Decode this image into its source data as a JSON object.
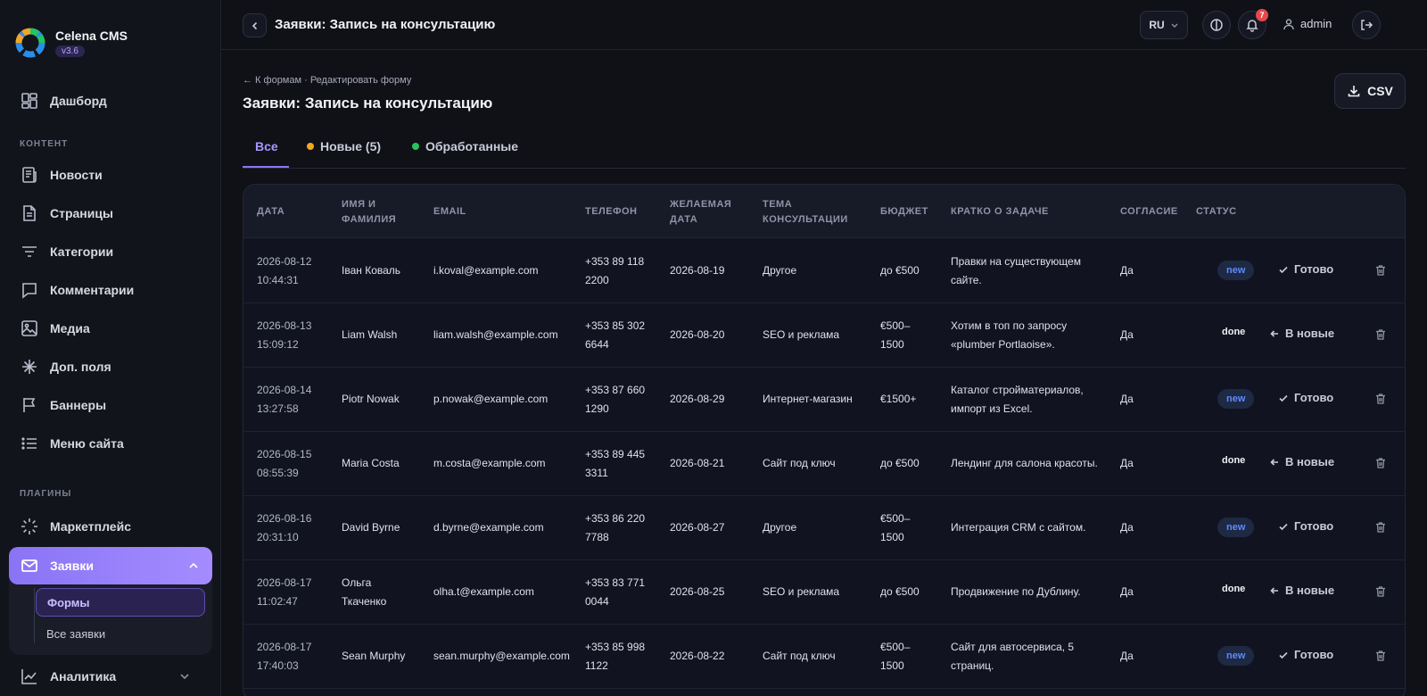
{
  "brand": {
    "title": "Celena CMS",
    "version": "v3.6"
  },
  "sidebar": {
    "dashboard": "Дашборд",
    "section_content": "КОНТЕНТ",
    "items": [
      {
        "label": "Новости",
        "icon": "news-icon"
      },
      {
        "label": "Страницы",
        "icon": "page-icon"
      },
      {
        "label": "Категории",
        "icon": "categories-icon"
      },
      {
        "label": "Комментарии",
        "icon": "comment-icon"
      },
      {
        "label": "Медиа",
        "icon": "image-icon"
      },
      {
        "label": "Доп. поля",
        "icon": "sparkle-icon"
      },
      {
        "label": "Баннеры",
        "icon": "flag-icon"
      },
      {
        "label": "Меню сайта",
        "icon": "list-icon"
      }
    ],
    "section_plugins": "ПЛАГИНЫ",
    "marketplace": "Маркетплейс",
    "requests": "Заявки",
    "sub_forms": "Формы",
    "sub_all": "Все заявки",
    "analytics": "Аналитика"
  },
  "topbar": {
    "title": "Заявки: Запись на консультацию",
    "lang": "RU",
    "notifications": "7",
    "user": "admin"
  },
  "page": {
    "breadcrumb": "← К формам · Редактировать форму",
    "title": "Заявки: Запись на консультацию",
    "csv": "CSV"
  },
  "tabs": {
    "all": "Все",
    "new": "Новые (5)",
    "processed": "Обработанные"
  },
  "colors": {
    "accent": "#8a74f5",
    "new_dot": "#f5a524",
    "processed_dot": "#22c55e"
  },
  "table": {
    "headers": {
      "date": "ДАТА",
      "name_1": "ИМЯ И",
      "name_2": "ФАМИЛИЯ",
      "email": "EMAIL",
      "phone": "ТЕЛЕФОН",
      "wish_1": "ЖЕЛАЕМАЯ",
      "wish_2": "ДАТА",
      "topic_1": "ТЕМА",
      "topic_2": "КОНСУЛЬТАЦИИ",
      "budget": "БЮДЖЕТ",
      "task": "КРАТКО О ЗАДАЧЕ",
      "consent": "СОГЛАСИЕ",
      "status": "СТАТУС"
    },
    "rows": [
      {
        "date": "2026-08-12",
        "time": "10:44:31",
        "name1": "Іван Коваль",
        "name2": "",
        "email": "i.koval@example.com",
        "phone1": "+353 89 118",
        "phone2": "2200",
        "wish": "2026-08-19",
        "topic": "Другое",
        "budget1": "до €500",
        "budget2": "",
        "task1": "Правки на существующем",
        "task2": "сайте.",
        "consent": "Да",
        "status": "new",
        "action": "Готово"
      },
      {
        "date": "2026-08-13",
        "time": "15:09:12",
        "name1": "Liam Walsh",
        "name2": "",
        "email": "liam.walsh@example.com",
        "phone1": "+353 85 302",
        "phone2": "6644",
        "wish": "2026-08-20",
        "topic": "SEO и реклама",
        "budget1": "€500–",
        "budget2": "1500",
        "task1": "Хотим в топ по запросу",
        "task2": "«plumber Portlaoise».",
        "consent": "Да",
        "status": "done",
        "action": "В новые"
      },
      {
        "date": "2026-08-14",
        "time": "13:27:58",
        "name1": "Piotr Nowak",
        "name2": "",
        "email": "p.nowak@example.com",
        "phone1": "+353 87 660",
        "phone2": "1290",
        "wish": "2026-08-29",
        "topic": "Интернет-магазин",
        "budget1": "€1500+",
        "budget2": "",
        "task1": "Каталог стройматериалов,",
        "task2": "импорт из Excel.",
        "consent": "Да",
        "status": "new",
        "action": "Готово"
      },
      {
        "date": "2026-08-15",
        "time": "08:55:39",
        "name1": "Maria Costa",
        "name2": "",
        "email": "m.costa@example.com",
        "phone1": "+353 89 445",
        "phone2": "3311",
        "wish": "2026-08-21",
        "topic": "Сайт под ключ",
        "budget1": "до €500",
        "budget2": "",
        "task1": "Лендинг для салона красоты.",
        "task2": "",
        "consent": "Да",
        "status": "done",
        "action": "В новые"
      },
      {
        "date": "2026-08-16",
        "time": "20:31:10",
        "name1": "David Byrne",
        "name2": "",
        "email": "d.byrne@example.com",
        "phone1": "+353 86 220",
        "phone2": "7788",
        "wish": "2026-08-27",
        "topic": "Другое",
        "budget1": "€500–",
        "budget2": "1500",
        "task1": "Интеграция CRM с сайтом.",
        "task2": "",
        "consent": "Да",
        "status": "new",
        "action": "Готово"
      },
      {
        "date": "2026-08-17",
        "time": "11:02:47",
        "name1": "Ольга",
        "name2": "Ткаченко",
        "email": "olha.t@example.com",
        "phone1": "+353 83 771",
        "phone2": "0044",
        "wish": "2026-08-25",
        "topic": "SEO и реклама",
        "budget1": "до €500",
        "budget2": "",
        "task1": "Продвижение по Дублину.",
        "task2": "",
        "consent": "Да",
        "status": "done",
        "action": "В новые"
      },
      {
        "date": "2026-08-17",
        "time": "17:40:03",
        "name1": "Sean Murphy",
        "name2": "",
        "email": "sean.murphy@example.com",
        "phone1": "+353 85 998",
        "phone2": "1122",
        "wish": "2026-08-22",
        "topic": "Сайт под ключ",
        "budget1": "€500–",
        "budget2": "1500",
        "task1": "Сайт для автосервиса, 5",
        "task2": "страниц.",
        "consent": "Да",
        "status": "new",
        "action": "Готово"
      }
    ]
  }
}
